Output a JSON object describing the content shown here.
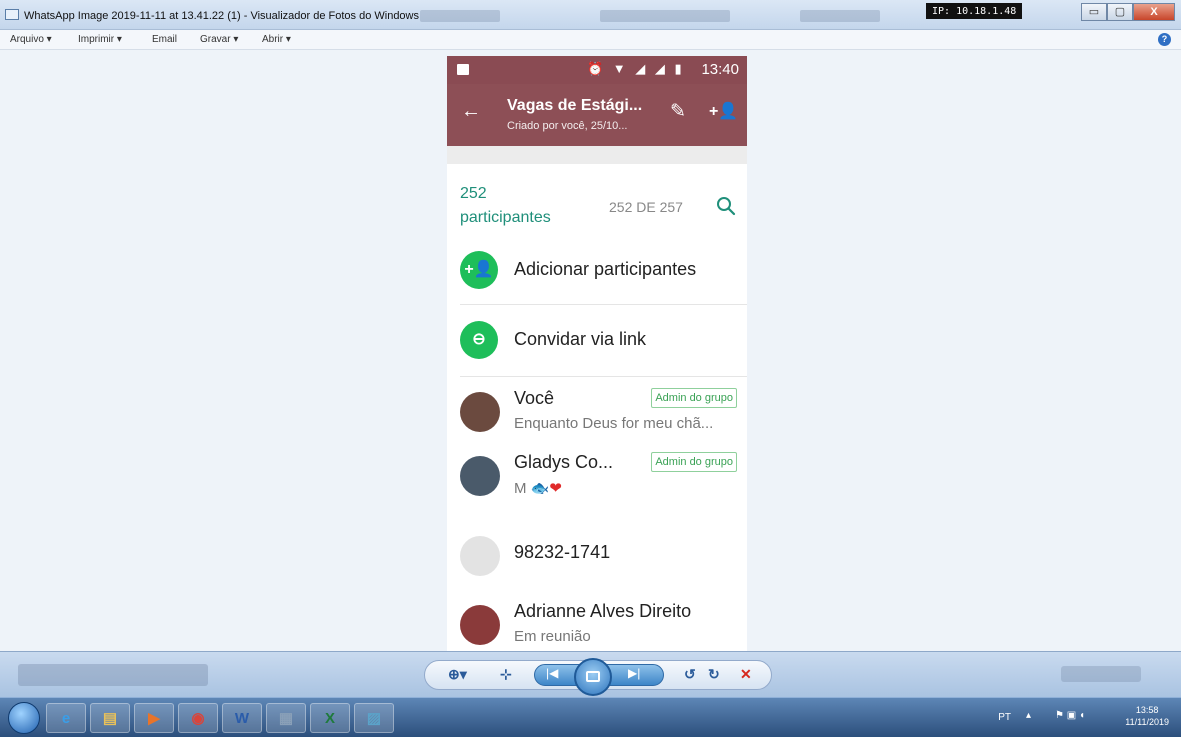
{
  "window": {
    "title": "WhatsApp Image 2019-11-11 at 13.41.22 (1) - Visualizador de Fotos do Windows",
    "ip_badge": "IP: 10.18.1.48",
    "minimize_glyph": "▭",
    "maximize_glyph": "▢",
    "close_glyph": "X"
  },
  "menu": {
    "items": [
      "Arquivo ▾",
      "Imprimir ▾",
      "Email",
      "Gravar ▾",
      "Abrir ▾"
    ],
    "help_glyph": "?"
  },
  "phone": {
    "status_time": "13:40",
    "status_icons": "⏰ ▼ ◢ ◢ ▮",
    "group_name": "Vagas de Estági...",
    "group_subtitle": "Criado por você, 25/10...",
    "participants_label_line1": "252",
    "participants_label_line2": "participantes",
    "count_label": "252 DE 257",
    "actions": [
      {
        "label": "Adicionar participantes",
        "icon": "add-person-icon",
        "glyph": "+👤"
      },
      {
        "label": "Convidar via link",
        "icon": "link-icon",
        "glyph": "⊖"
      }
    ],
    "members": [
      {
        "name": "Você",
        "status": "Enquanto Deus for meu chã...",
        "admin": "Admin do grupo",
        "avatar_color": "#6b4a3f"
      },
      {
        "name": "Gladys Co...",
        "status": "M 🐟",
        "status_heart": "❤",
        "admin": "Admin do grupo",
        "avatar_color": "#4a5a6a"
      },
      {
        "name": "98232-1741",
        "status": "",
        "admin": "",
        "avatar_color": "#e3e3e3"
      },
      {
        "name": "Adrianne Alves Direito",
        "status": "Em reunião",
        "admin": "",
        "avatar_color": "#8a3a3a"
      }
    ]
  },
  "viewer_toolbar": {
    "zoom_glyph": "⊕▾",
    "fit_glyph": "⊹",
    "prev_glyph": "|◀",
    "next_glyph": "▶|",
    "rotate_ccw_glyph": "↺",
    "rotate_cw_glyph": "↻",
    "delete_glyph": "✕"
  },
  "taskbar": {
    "apps": [
      {
        "name": "ie",
        "glyph": "e",
        "color": "#3a9ee8"
      },
      {
        "name": "explorer",
        "glyph": "▤",
        "color": "#e8c15a"
      },
      {
        "name": "media-player",
        "glyph": "▶",
        "color": "#e8742a"
      },
      {
        "name": "chrome",
        "glyph": "◉",
        "color": "#d9443a"
      },
      {
        "name": "word",
        "glyph": "W",
        "color": "#2a5caa"
      },
      {
        "name": "calculator",
        "glyph": "▦",
        "color": "#8aa0b8"
      },
      {
        "name": "excel",
        "glyph": "X",
        "color": "#1e7a3c"
      },
      {
        "name": "photo-viewer",
        "glyph": "▨",
        "color": "#5ba3c9"
      }
    ],
    "language": "PT",
    "time": "13:58",
    "date": "11/11/2019"
  },
  "colors": {
    "header_maroon": "#8d4f56",
    "whatsapp_green": "#1ebe5a",
    "teal_text": "#1f8f7a"
  }
}
